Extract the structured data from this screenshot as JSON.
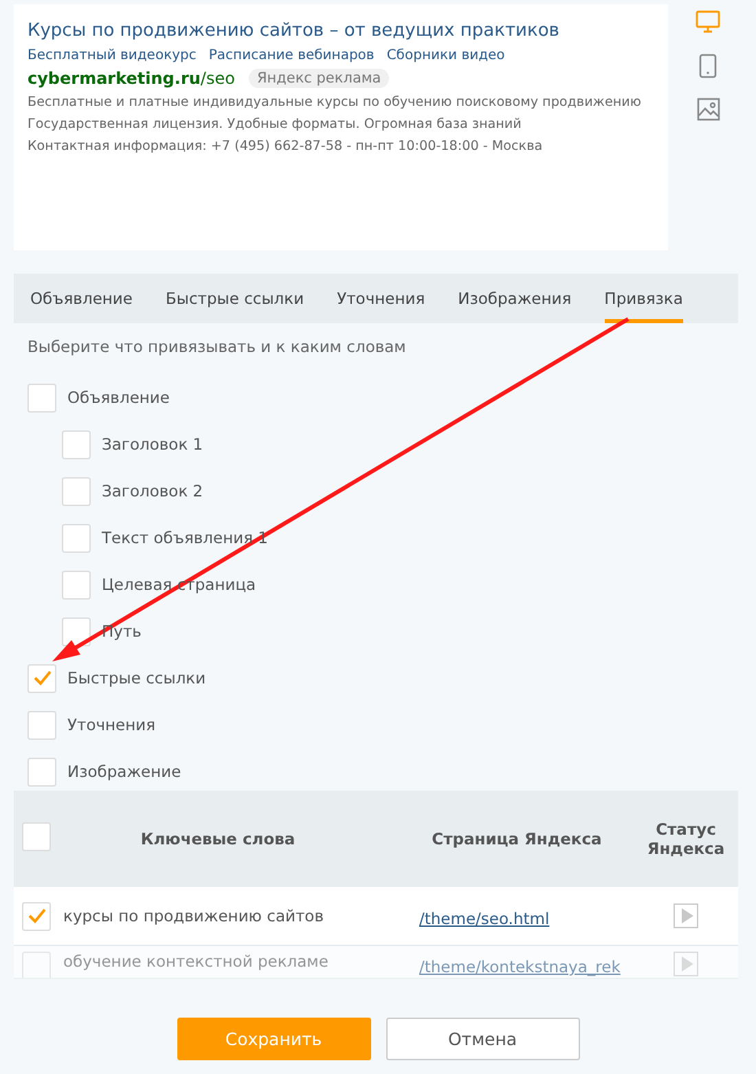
{
  "preview": {
    "title": "Курсы по продвижению сайтов – от ведущих практиков",
    "sitelinks": [
      "Бесплатный видеокурс",
      "Расписание вебинаров",
      "Сборники видео"
    ],
    "domain": "cybermarketing.ru",
    "path": "/seo",
    "ad_badge": "Яндекс реклама",
    "lines": [
      "Бесплатные и платные индивидуальные курсы по обучению поисковому продвижению",
      "Государственная лицензия. Удобные форматы. Огромная база знаний",
      "Контактная информация: +7 (495) 662-87-58 - пн-пт 10:00-18:00 - Москва"
    ]
  },
  "device_toggle": [
    {
      "kind": "desktop",
      "selected": true
    },
    {
      "kind": "mobile",
      "selected": false
    },
    {
      "kind": "image",
      "selected": false
    }
  ],
  "tabs": [
    {
      "label": "Объявление",
      "selected": false
    },
    {
      "label": "Быстрые ссылки",
      "selected": false
    },
    {
      "label": "Уточнения",
      "selected": false
    },
    {
      "label": "Изображения",
      "selected": false
    },
    {
      "label": "Привязка",
      "selected": true
    }
  ],
  "binding": {
    "hint": "Выберите что привязывать и к каким словам",
    "options": [
      {
        "label": "Объявление",
        "checked": false,
        "children": [
          {
            "label": "Заголовок 1",
            "checked": false
          },
          {
            "label": "Заголовок 2",
            "checked": false
          },
          {
            "label": "Текст объявления 1",
            "checked": false
          },
          {
            "label": "Целевая страница",
            "checked": false
          },
          {
            "label": "Путь",
            "checked": false
          }
        ]
      },
      {
        "label": "Быстрые ссылки",
        "checked": true
      },
      {
        "label": "Уточнения",
        "checked": false
      },
      {
        "label": "Изображение",
        "checked": false
      }
    ]
  },
  "keywords_table": {
    "select_all_checked": false,
    "columns": [
      "Ключевые слова",
      "Страница Яндекса",
      "Статус Яндекса"
    ],
    "rows": [
      {
        "checked": true,
        "keyword": "курсы по продвижению сайтов",
        "page": "/theme/seo.html",
        "faded": false
      },
      {
        "checked": false,
        "keyword": "обучение контекстной рекламе",
        "page": "/theme/kontekstnaya_rek",
        "faded": true
      }
    ]
  },
  "buttons": [
    {
      "label": "Сохранить",
      "kind": "primary"
    },
    {
      "label": "Отмена",
      "kind": "secondary"
    }
  ]
}
